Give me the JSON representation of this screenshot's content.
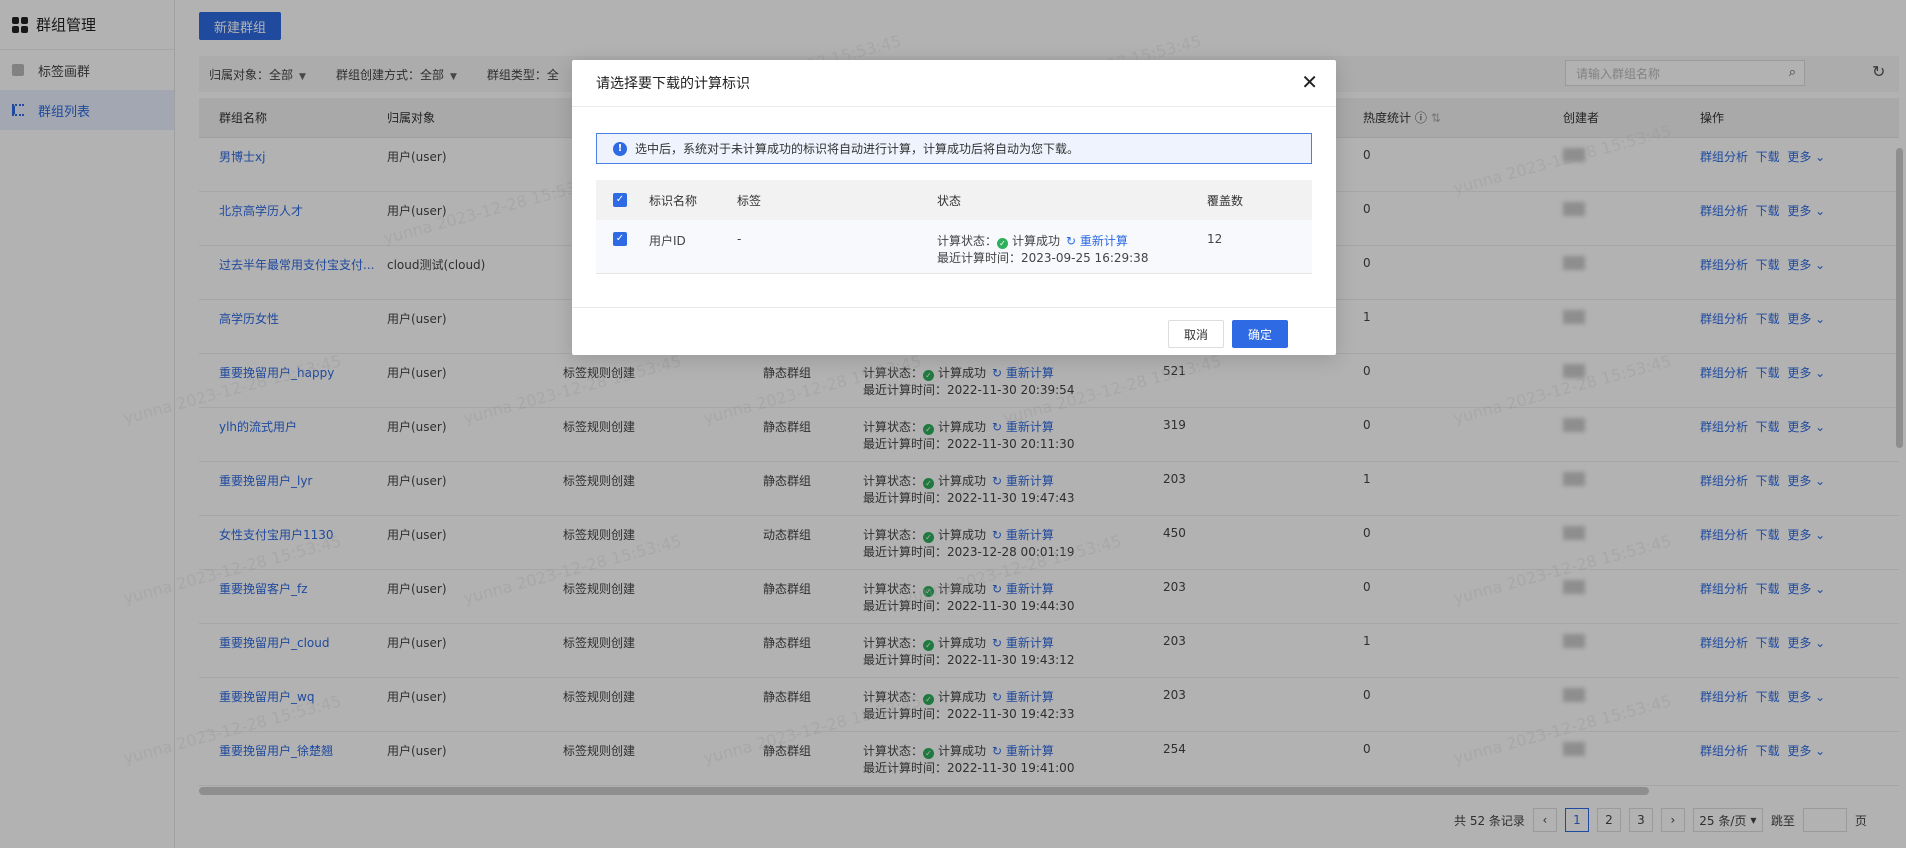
{
  "sidebar": {
    "title": "群组管理",
    "items": [
      {
        "label": "标签画群"
      },
      {
        "label": "群组列表"
      }
    ]
  },
  "toolbar": {
    "new_group": "新建群组"
  },
  "filters": {
    "owner": "归属对象：全部",
    "method": "群组创建方式：全部",
    "type": "群组类型：全",
    "search_placeholder": "请输入群组名称"
  },
  "table": {
    "headers": [
      "群组名称",
      "归属对象",
      "",
      "",
      "",
      "",
      "热度统计",
      "创建者",
      "操作"
    ],
    "rows": [
      {
        "name": "男博士xj",
        "owner": "用户(user)",
        "method": "",
        "type": "",
        "status": "",
        "time": "",
        "count": "",
        "heat": "0"
      },
      {
        "name": "北京高学历人才",
        "owner": "用户(user)",
        "method": "",
        "type": "",
        "status": "",
        "time": "",
        "count": "",
        "heat": "0"
      },
      {
        "name": "过去半年最常用支付宝支付...",
        "owner": "cloud测试(cloud)",
        "method": "",
        "type": "",
        "status": "",
        "time": "",
        "count": "",
        "heat": "0"
      },
      {
        "name": "高学历女性",
        "owner": "用户(user)",
        "method": "",
        "type": "",
        "status": "",
        "time": "",
        "count": "",
        "heat": "1"
      },
      {
        "name": "重要挽留用户_happy",
        "owner": "用户(user)",
        "method": "标签规则创建",
        "type": "静态群组",
        "status": "计算成功",
        "time": "最近计算时间：2022-11-30 20:39:54",
        "count": "521",
        "heat": "0"
      },
      {
        "name": "ylh的流式用户",
        "owner": "用户(user)",
        "method": "标签规则创建",
        "type": "静态群组",
        "status": "计算成功",
        "time": "最近计算时间：2022-11-30 20:11:30",
        "count": "319",
        "heat": "0"
      },
      {
        "name": "重要挽留用户_lyr",
        "owner": "用户(user)",
        "method": "标签规则创建",
        "type": "静态群组",
        "status": "计算成功",
        "time": "最近计算时间：2022-11-30 19:47:43",
        "count": "203",
        "heat": "1"
      },
      {
        "name": "女性支付宝用户1130",
        "owner": "用户(user)",
        "method": "标签规则创建",
        "type": "动态群组",
        "status": "计算成功",
        "time": "最近计算时间：2023-12-28 00:01:19",
        "count": "450",
        "heat": "0"
      },
      {
        "name": "重要挽留客户_fz",
        "owner": "用户(user)",
        "method": "标签规则创建",
        "type": "静态群组",
        "status": "计算成功",
        "time": "最近计算时间：2022-11-30 19:44:30",
        "count": "203",
        "heat": "0"
      },
      {
        "name": "重要挽留用户_cloud",
        "owner": "用户(user)",
        "method": "标签规则创建",
        "type": "静态群组",
        "status": "计算成功",
        "time": "最近计算时间：2022-11-30 19:43:12",
        "count": "203",
        "heat": "1"
      },
      {
        "name": "重要挽留用户_wq",
        "owner": "用户(user)",
        "method": "标签规则创建",
        "type": "静态群组",
        "status": "计算成功",
        "time": "最近计算时间：2022-11-30 19:42:33",
        "count": "203",
        "heat": "0"
      },
      {
        "name": "重要挽留用户_徐楚翘",
        "owner": "用户(user)",
        "method": "标签规则创建",
        "type": "静态群组",
        "status": "计算成功",
        "time": "最近计算时间：2022-11-30 19:41:00",
        "count": "254",
        "heat": "0"
      }
    ],
    "status_prefix": "计算状态：",
    "recalc": "重新计算",
    "actions": {
      "analyze": "群组分析",
      "download": "下载",
      "more": "更多"
    }
  },
  "pagination": {
    "total": "共 52 条记录",
    "pages": [
      "1",
      "2",
      "3"
    ],
    "page_size": "25 条/页",
    "jump": "跳至",
    "page_suffix": "页"
  },
  "watermark": "yunna 2023-12-28 15:53:45",
  "modal": {
    "title": "请选择要下载的计算标识",
    "alert": "选中后，系统对于未计算成功的标识将自动进行计算，计算成功后将自动为您下载。",
    "headers": {
      "name": "标识名称",
      "tag": "标签",
      "status": "状态",
      "coverage": "覆盖数"
    },
    "row": {
      "name": "用户ID",
      "tag": "-",
      "status_prefix": "计算状态：",
      "status": "计算成功",
      "recalc": "重新计算",
      "time": "最近计算时间：2023-09-25 16:29:38",
      "coverage": "12"
    },
    "cancel": "取消",
    "confirm": "确定"
  },
  "colors": {
    "primary": "#2d6ae3",
    "success": "#2eaf5c"
  }
}
